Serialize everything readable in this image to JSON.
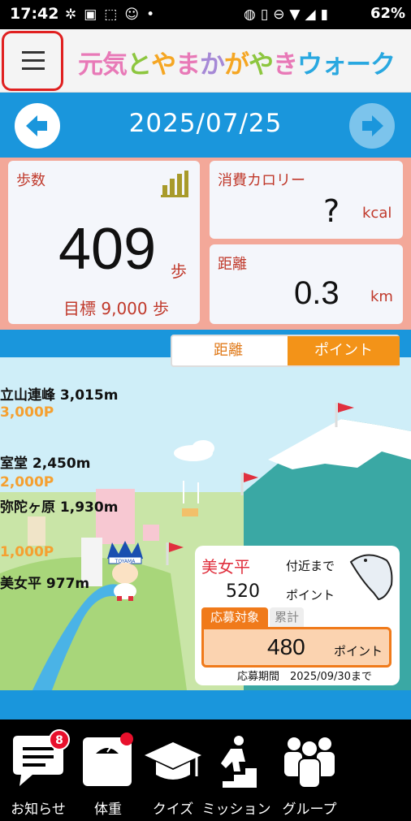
{
  "status_bar": {
    "time": "17:42",
    "battery": "62%",
    "left_icons": [
      "slack-icon",
      "app-icon",
      "cast-icon",
      "app-icon",
      "dot-icon"
    ],
    "right_icons": [
      "nfc-icon",
      "vibrate-icon",
      "dnd-icon",
      "wifi-icon",
      "signal-icon",
      "battery-icon"
    ]
  },
  "header": {
    "title_parts": [
      "元気",
      "と",
      "や",
      "ま",
      "か",
      "が",
      "や",
      "き",
      "ウォーク"
    ],
    "menu_icon": "hamburger-icon"
  },
  "date_bar": {
    "date": "2025/07/25",
    "prev_icon": "arrow-left-icon",
    "next_icon": "arrow-right-icon"
  },
  "stats": {
    "steps": {
      "label": "歩数",
      "value": "409",
      "unit": "歩",
      "goal": "目標 9,000 歩"
    },
    "calories": {
      "label": "消費カロリー",
      "value": "?",
      "unit": "kcal"
    },
    "distance": {
      "label": "距離",
      "value": "0.3",
      "unit": "km"
    }
  },
  "map": {
    "toggle": {
      "distance": "距離",
      "points": "ポイント",
      "selected": "ポイント"
    },
    "spots": [
      {
        "name": "立山連峰 3,015m",
        "points": "3,000P"
      },
      {
        "name": "室堂 2,450m",
        "points": "2,000P"
      },
      {
        "name": "弥陀ヶ原 1,930m",
        "points": ""
      },
      {
        "name": "美女平 977m",
        "points": "1,000P"
      }
    ],
    "mascot_text": "TOYAMA",
    "info": {
      "location": "美女平",
      "near": "付近まで",
      "points_to_next": "520",
      "points_unit": "ポイント",
      "tab_active": "応募対象",
      "tab_inactive": "累計",
      "apply_points": "480",
      "apply_unit": "ポイント",
      "period": "応募期間　2025/09/30まで"
    }
  },
  "bottom_nav": [
    {
      "label": "お知らせ",
      "icon": "chat-icon",
      "badge": "8"
    },
    {
      "label": "体重",
      "icon": "scale-icon",
      "badge": ""
    },
    {
      "label": "クイズ",
      "icon": "graduation-cap-icon",
      "badge": ""
    },
    {
      "label": "ミッション",
      "icon": "climbing-stairs-icon",
      "badge": ""
    },
    {
      "label": "グループ",
      "icon": "group-icon",
      "badge": ""
    }
  ],
  "colors": {
    "primary_blue": "#1a96dc",
    "stats_bg": "#f3a899",
    "accent_orange": "#f39318",
    "label_red": "#c0392b",
    "badge_red": "#e8102c"
  }
}
